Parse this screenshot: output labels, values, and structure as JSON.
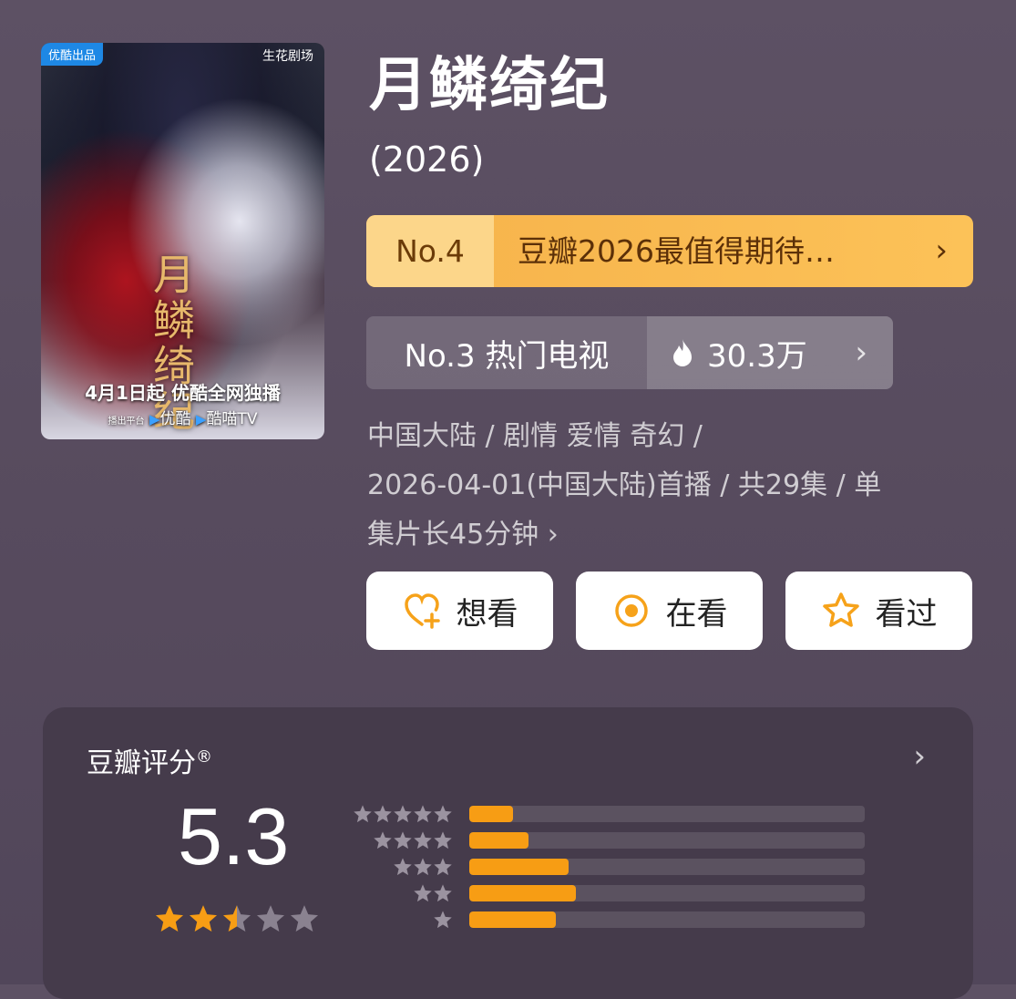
{
  "poster": {
    "badge": "优酷出品",
    "studio": "生花剧场",
    "title_art": "月鳞绮纪",
    "release": "4月1日起 优酷全网独播",
    "platform_label": "播出平台",
    "platform1": "优酷",
    "platform2": "酷喵TV"
  },
  "title": "月鳞绮纪",
  "year": "(2026)",
  "rank": {
    "number": "No.4",
    "text": "豆瓣2026最值得期待…",
    "chevron": "›"
  },
  "hot": {
    "label": "No.3 热门电视",
    "count": "30.3万",
    "icon": "fire-icon",
    "chevron": "›"
  },
  "meta": {
    "line1": "中国大陆 / 剧情 爱情 奇幻 /",
    "line2": "2026-04-01(中国大陆)首播 / 共29集 / 单",
    "line3": "集片长45分钟 ›"
  },
  "actions": [
    {
      "label": "想看",
      "icon": "heart-plus-icon"
    },
    {
      "label": "在看",
      "icon": "target-icon"
    },
    {
      "label": "看过",
      "icon": "star-outline-icon"
    }
  ],
  "rating": {
    "label": "豆瓣评分",
    "registered": "®",
    "score": "5.3",
    "stars_value": 2.5,
    "star_color": "#f79d14",
    "chevron": "›",
    "distribution": [
      {
        "stars": 5,
        "fraction": 0.11
      },
      {
        "stars": 4,
        "fraction": 0.15
      },
      {
        "stars": 3,
        "fraction": 0.25
      },
      {
        "stars": 2,
        "fraction": 0.27
      },
      {
        "stars": 1,
        "fraction": 0.22
      }
    ]
  },
  "colors": {
    "accent": "#fcc258",
    "bar_fill": "#f79d14",
    "icon_orange": "#f6a21a"
  }
}
